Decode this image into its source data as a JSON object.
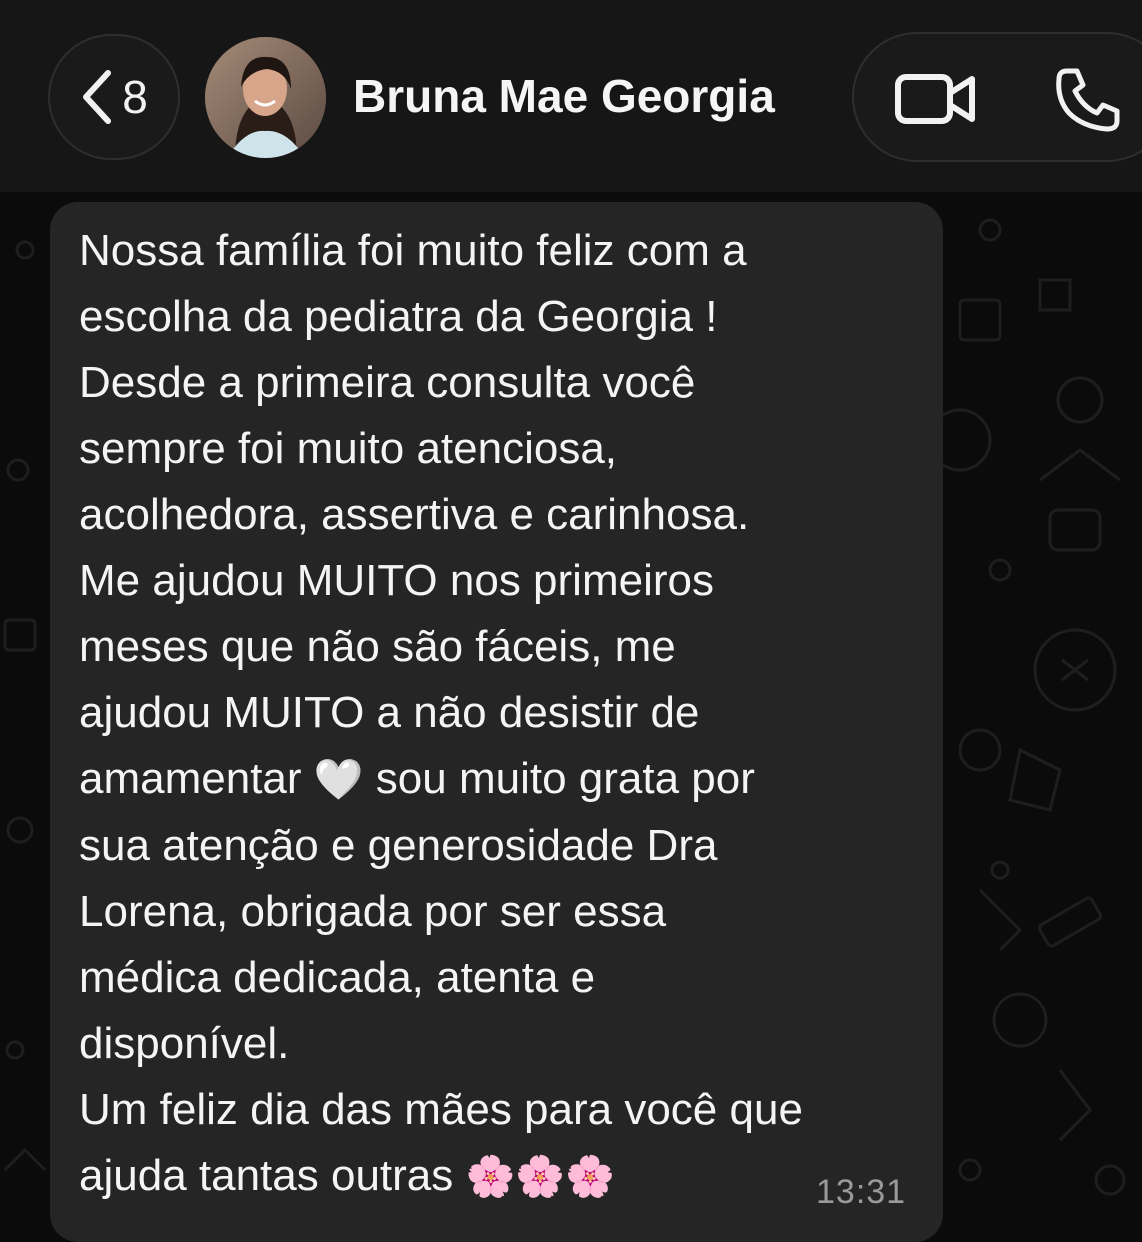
{
  "header": {
    "back_count": "8",
    "contact_name": "Bruna Mae Georgia",
    "icons": {
      "back": "chevron-left-icon",
      "video": "video-camera-icon",
      "call": "phone-icon"
    }
  },
  "message": {
    "lines": [
      "Nossa família foi muito feliz com a",
      "escolha da pediatra da Georgia  !",
      "Desde a primeira consulta você",
      "sempre foi muito atenciosa,",
      "acolhedora, assertiva e carinhosa.",
      "Me ajudou MUITO nos primeiros",
      "meses que não são fáceis, me",
      "ajudou MUITO a não desistir de",
      "sua atenção e generosidade Dra",
      "Lorena, obrigada por ser essa",
      "médica dedicada, atenta e",
      "disponível.",
      "Um feliz dia das mães para você que"
    ],
    "line9_before_emoji": "amamentar ",
    "heart_emoji": "🤍",
    "line9_after_emoji": " sou muito grata por",
    "last_line_text": "ajuda tantas outras ",
    "blossom_emojis": "🌸🌸🌸",
    "time": "13:31"
  },
  "colors": {
    "background": "#0b0b0b",
    "header": "#161616",
    "bubble": "#252525",
    "text": "#f4f4f4",
    "timestamp": "#9a9a9a"
  }
}
